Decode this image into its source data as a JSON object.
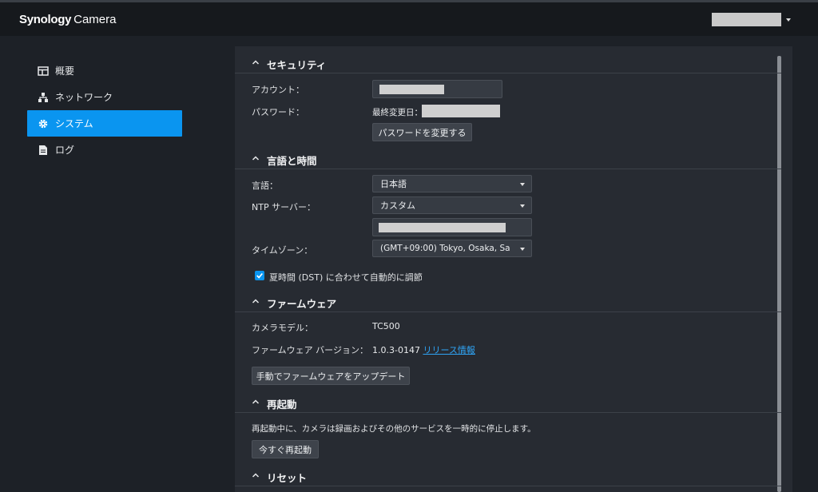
{
  "header": {
    "brand_bold": "Synology",
    "brand_product": "Camera"
  },
  "sidebar": {
    "items": [
      {
        "label": "概要",
        "icon": "overview-icon"
      },
      {
        "label": "ネットワーク",
        "icon": "network-icon"
      },
      {
        "label": "システム",
        "icon": "gear-icon",
        "active": true
      },
      {
        "label": "ログ",
        "icon": "log-icon"
      }
    ]
  },
  "security": {
    "title": "セキュリティ",
    "account_label": "アカウント：",
    "password_label": "パスワード：",
    "last_changed_label": "最終変更日：",
    "change_password_button": "パスワードを変更する"
  },
  "language_time": {
    "title": "言語と時間",
    "language_label": "言語：",
    "language_value": "日本語",
    "ntp_label": "NTP サーバー：",
    "ntp_value": "カスタム",
    "timezone_label": "タイムゾーン：",
    "timezone_value": "(GMT+09:00) Tokyo, Osaka, Sa",
    "dst_label": "夏時間 (DST) に合わせて自動的に調節",
    "dst_checked": true
  },
  "firmware": {
    "title": "ファームウェア",
    "model_label": "カメラモデル：",
    "model_value": "TC500",
    "version_label": "ファームウェア バージョン：",
    "version_value": "1.0.3-0147",
    "release_notes_link": "リリース情報",
    "manual_update_button": "手動でファームウェアをアップデート"
  },
  "reboot": {
    "title": "再起動",
    "description": "再起動中に、カメラは録画およびその他のサービスを一時的に停止します。",
    "reboot_now_button": "今すぐ再起動"
  },
  "reset": {
    "title": "リセット"
  },
  "colors": {
    "accent": "#0a95f0",
    "link": "#2fa4f5",
    "panel_bg": "#272b32",
    "page_bg": "#1d2127"
  }
}
